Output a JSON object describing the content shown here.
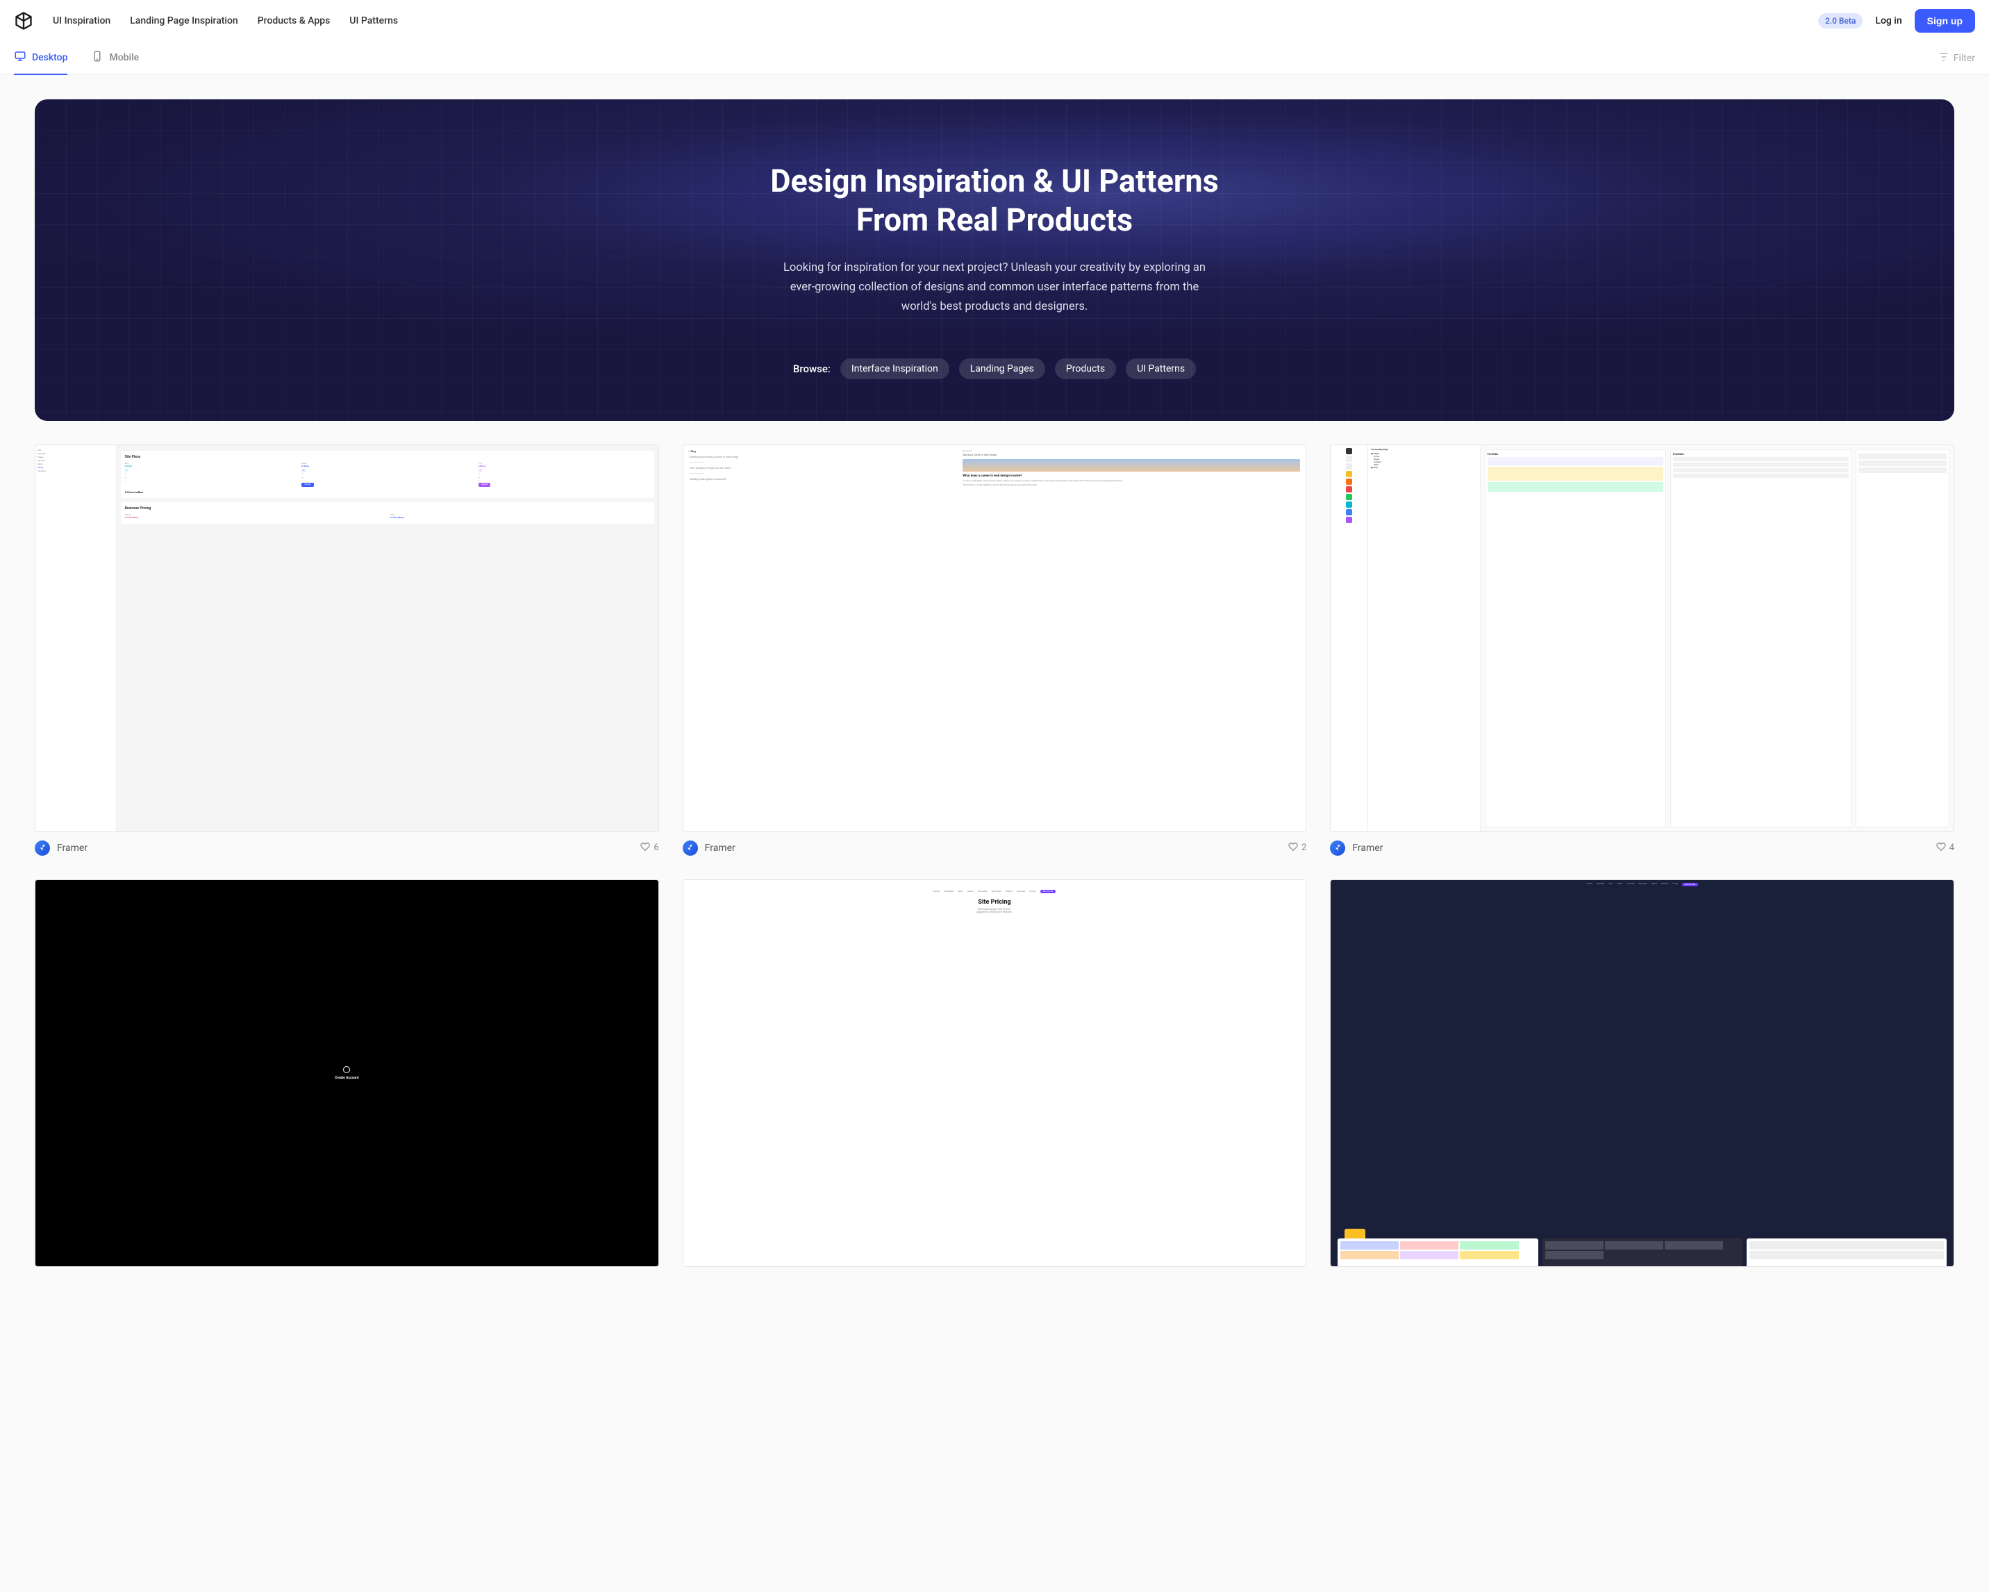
{
  "header": {
    "nav": {
      "ui_inspiration": "UI Inspiration",
      "landing_page": "Landing Page Inspiration",
      "products_apps": "Products & Apps",
      "ui_patterns": "UI Patterns"
    },
    "beta_badge": "2.0 Beta",
    "login": "Log in",
    "signup": "Sign up"
  },
  "tabs": {
    "desktop": "Desktop",
    "mobile": "Mobile",
    "filter": "Filter"
  },
  "hero": {
    "title_line1": "Design Inspiration & UI Patterns",
    "title_line2": "From Real Products",
    "subtitle": "Looking for inspiration for your next project? Unleash your creativity by exploring an ever-growing collection of designs and common user interface patterns from the world's best products and designers.",
    "browse_label": "Browse:",
    "pills": {
      "interface": "Interface Inspiration",
      "landing": "Landing Pages",
      "products": "Products",
      "patterns": "UI Patterns"
    }
  },
  "cards": [
    {
      "name": "Framer",
      "likes": "6"
    },
    {
      "name": "Framer",
      "likes": "2"
    },
    {
      "name": "Framer",
      "likes": "4"
    }
  ],
  "thumb_content": {
    "a": {
      "title1": "Site Plans",
      "prices": [
        "£10/mo",
        "£15/mo",
        "£30/mo"
      ],
      "title2": "£15/mo*editor",
      "title3": "Business Pricing",
      "custom": "Custom Billing"
    },
    "b": {
      "article_title": "Starting a Career in Web Design",
      "q": "What does a career in web design involve?"
    },
    "c": {
      "h1": "Portfolio",
      "h2": "Portfolio"
    },
    "d": {
      "title": "Create Account"
    },
    "e": {
      "title": "Site Pricing",
      "sub1": "Start building your site for free.",
      "sub2": "Upgrade to unlock more features."
    },
    "f": {
      "free": "Start for Free"
    }
  }
}
